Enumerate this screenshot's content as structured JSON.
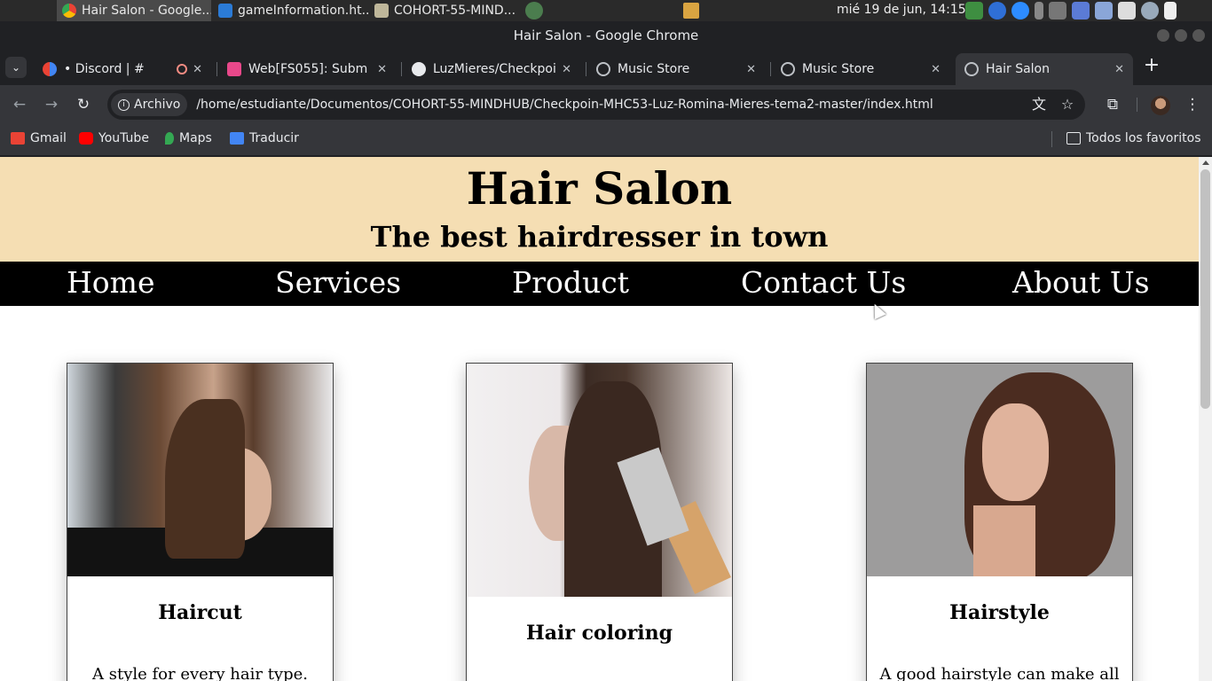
{
  "os": {
    "tasks": [
      {
        "label": "Hair Salon - Google...",
        "icon": "chrome-icon",
        "active": true
      },
      {
        "label": "gameInformation.ht...",
        "icon": "vscode-icon",
        "active": false
      },
      {
        "label": "COHORT-55-MIND...",
        "icon": "folder-icon",
        "active": false
      }
    ],
    "clock": "mié 19 de jun, 14:15"
  },
  "window": {
    "title": "Hair Salon - Google Chrome"
  },
  "tabs": [
    {
      "label": "• Discord | #",
      "icon": "discord-icon"
    },
    {
      "label": "Web[FS055]: Subm",
      "icon": "ublock-icon"
    },
    {
      "label": "LuzMieres/Checkpoi",
      "icon": "github-icon"
    },
    {
      "label": "Music Store",
      "icon": "globe-icon"
    },
    {
      "label": "Music Store",
      "icon": "globe-icon"
    },
    {
      "label": "Hair Salon",
      "icon": "globe-icon"
    }
  ],
  "toolbar": {
    "security_chip": "Archivo",
    "url": "/home/estudiante/Documentos/COHORT-55-MINDHUB/Checkpoin-MHC53-Luz-Romina-Mieres-tema2-master/index.html"
  },
  "bookmarks": {
    "items": [
      {
        "label": "Gmail",
        "icon": "gmail-icon"
      },
      {
        "label": "YouTube",
        "icon": "youtube-icon"
      },
      {
        "label": "Maps",
        "icon": "maps-icon"
      },
      {
        "label": "Traducir",
        "icon": "translate-icon"
      }
    ],
    "all_favorites": "Todos los favoritos"
  },
  "page": {
    "title": "Hair Salon",
    "subtitle": "The best hairdresser in town",
    "nav": [
      "Home",
      "Services",
      "Product",
      "Contact Us",
      "About Us"
    ],
    "cards": [
      {
        "title": "Haircut",
        "text": "A style for every hair type. Order"
      },
      {
        "title": "Hair coloring",
        "text": ""
      },
      {
        "title": "Hairstyle",
        "text": "A good hairstyle can make all the"
      }
    ]
  },
  "colors": {
    "header_bg": "#f5deb3",
    "nav_bg": "#000000",
    "chrome_dark": "#202124",
    "chrome_toolbar": "#35363a"
  }
}
